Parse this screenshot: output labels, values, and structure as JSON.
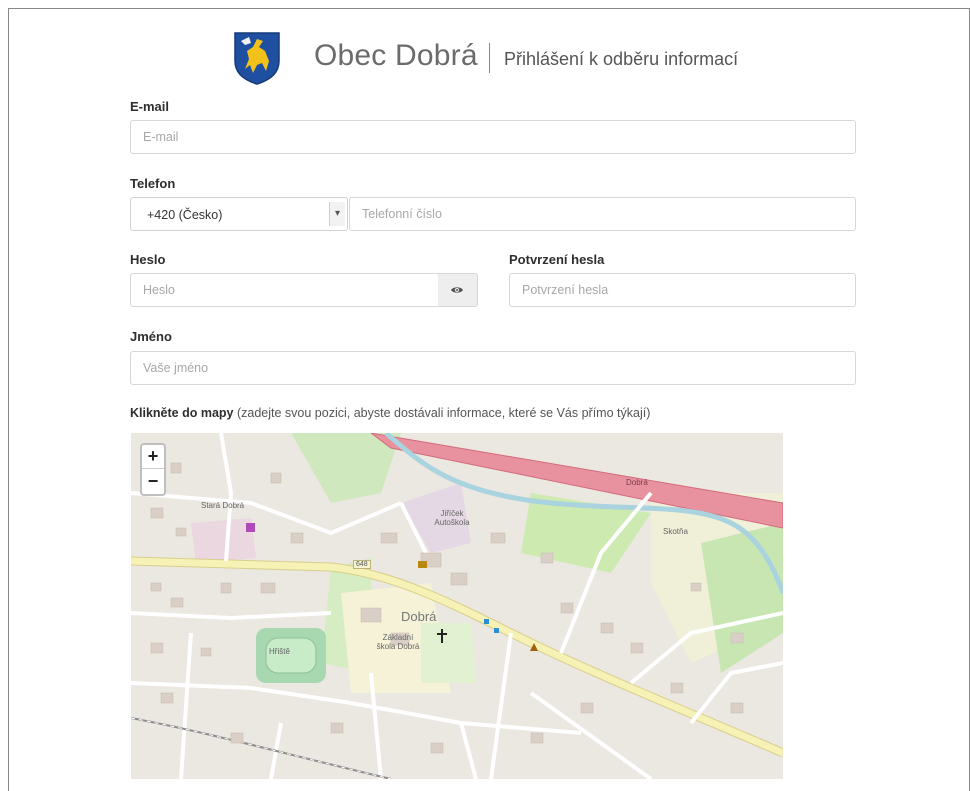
{
  "header": {
    "title": "Obec Dobrá",
    "subtitle": "Přihlášení k odběru informací",
    "colors": {
      "crest_blue": "#1f4fa0",
      "crest_gold": "#f2c21a"
    }
  },
  "form": {
    "email": {
      "label": "E-mail",
      "placeholder": "E-mail",
      "value": ""
    },
    "phone": {
      "label": "Telefon",
      "country_code": "+420 (Česko)",
      "placeholder": "Telefonní číslo",
      "value": ""
    },
    "password": {
      "label": "Heslo",
      "placeholder": "Heslo",
      "toggle_icon": "eye-icon"
    },
    "password_confirm": {
      "label": "Potvrzení hesla",
      "placeholder": "Potvrzení hesla"
    },
    "name": {
      "label": "Jméno",
      "placeholder": "Vaše jméno"
    },
    "map_hint_bold": "Klikněte do mapy",
    "map_hint_rest": "(zadejte svou pozici, abyste dostávali informace, které se Vás přímo týkají)"
  },
  "map": {
    "zoom_in": "+",
    "zoom_out": "−",
    "labels": {
      "stara_dobra": "Stará Dobrá",
      "autoskola": "Jiříček Autoškola",
      "dobra": "Dobrá",
      "skotna": "Skotňa",
      "skola": "Základní škola Dobrá",
      "hriste": "Hřiště",
      "road": "648",
      "hwy": "Dobrá"
    }
  }
}
